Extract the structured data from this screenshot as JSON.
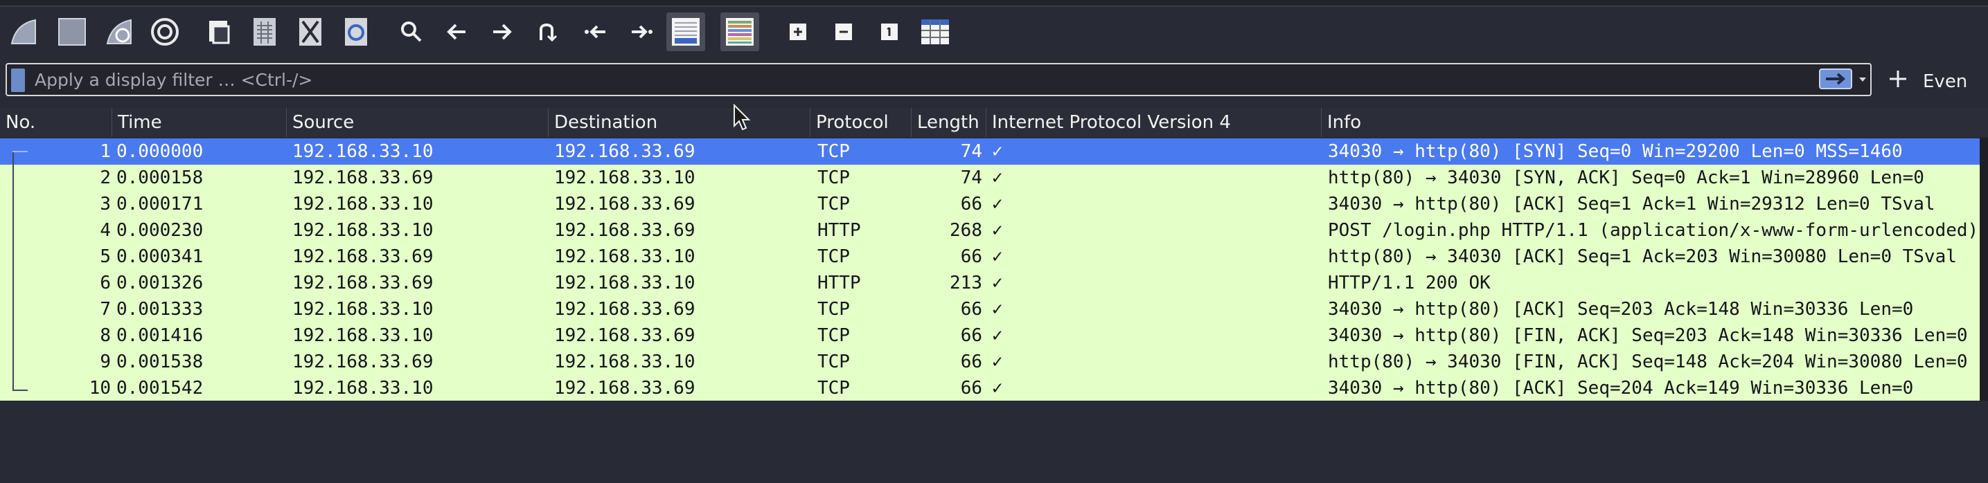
{
  "toolbar": {
    "icons": [
      "start-capture-icon",
      "stop-capture-icon",
      "restart-capture-icon",
      "capture-options-icon",
      "open-file-icon",
      "save-file-icon",
      "close-file-icon",
      "reload-file-icon",
      "find-packet-icon",
      "go-back-icon",
      "go-forward-icon",
      "go-to-packet-icon",
      "first-packet-icon",
      "last-packet-icon",
      "autoscroll-icon",
      "colorize-icon",
      "zoom-in-icon",
      "zoom-out-icon",
      "normal-size-icon",
      "resize-columns-icon"
    ]
  },
  "filter": {
    "placeholder": "Apply a display filter … <Ctrl-/>",
    "value": "",
    "expression_button": "Even"
  },
  "columns": [
    "No.",
    "Time",
    "Source",
    "Destination",
    "Protocol",
    "Length",
    "Internet Protocol Version 4",
    "Info"
  ],
  "check_glyph": "✓",
  "packets": [
    {
      "no": "1",
      "time": "0.000000",
      "source": "192.168.33.10",
      "destination": "192.168.33.69",
      "protocol": "TCP",
      "length": "74",
      "info": "34030 → http(80) [SYN] Seq=0 Win=29200 Len=0 MSS=1460"
    },
    {
      "no": "2",
      "time": "0.000158",
      "source": "192.168.33.69",
      "destination": "192.168.33.10",
      "protocol": "TCP",
      "length": "74",
      "info": "http(80) → 34030 [SYN, ACK] Seq=0 Ack=1 Win=28960 Len=0"
    },
    {
      "no": "3",
      "time": "0.000171",
      "source": "192.168.33.10",
      "destination": "192.168.33.69",
      "protocol": "TCP",
      "length": "66",
      "info": "34030 → http(80) [ACK] Seq=1 Ack=1 Win=29312 Len=0 TSval"
    },
    {
      "no": "4",
      "time": "0.000230",
      "source": "192.168.33.10",
      "destination": "192.168.33.69",
      "protocol": "HTTP",
      "length": "268",
      "info": "POST /login.php HTTP/1.1  (application/x-www-form-urlencoded)"
    },
    {
      "no": "5",
      "time": "0.000341",
      "source": "192.168.33.69",
      "destination": "192.168.33.10",
      "protocol": "TCP",
      "length": "66",
      "info": "http(80) → 34030 [ACK] Seq=1 Ack=203 Win=30080 Len=0 TSval"
    },
    {
      "no": "6",
      "time": "0.001326",
      "source": "192.168.33.69",
      "destination": "192.168.33.10",
      "protocol": "HTTP",
      "length": "213",
      "info": "HTTP/1.1 200 OK"
    },
    {
      "no": "7",
      "time": "0.001333",
      "source": "192.168.33.10",
      "destination": "192.168.33.69",
      "protocol": "TCP",
      "length": "66",
      "info": "34030 → http(80) [ACK] Seq=203 Ack=148 Win=30336 Len=0"
    },
    {
      "no": "8",
      "time": "0.001416",
      "source": "192.168.33.10",
      "destination": "192.168.33.69",
      "protocol": "TCP",
      "length": "66",
      "info": "34030 → http(80) [FIN, ACK] Seq=203 Ack=148 Win=30336 Len=0"
    },
    {
      "no": "9",
      "time": "0.001538",
      "source": "192.168.33.69",
      "destination": "192.168.33.10",
      "protocol": "TCP",
      "length": "66",
      "info": "http(80) → 34030 [FIN, ACK] Seq=148 Ack=204 Win=30080 Len=0"
    },
    {
      "no": "10",
      "time": "0.001542",
      "source": "192.168.33.10",
      "destination": "192.168.33.69",
      "protocol": "TCP",
      "length": "66",
      "info": "34030 → http(80) [ACK] Seq=204 Ack=149 Win=30336 Len=0"
    }
  ],
  "selected_row": 1,
  "colors": {
    "background": "#282a36",
    "row_tcp_http": "#e4ffc7",
    "row_selected": "#4a7af0"
  }
}
